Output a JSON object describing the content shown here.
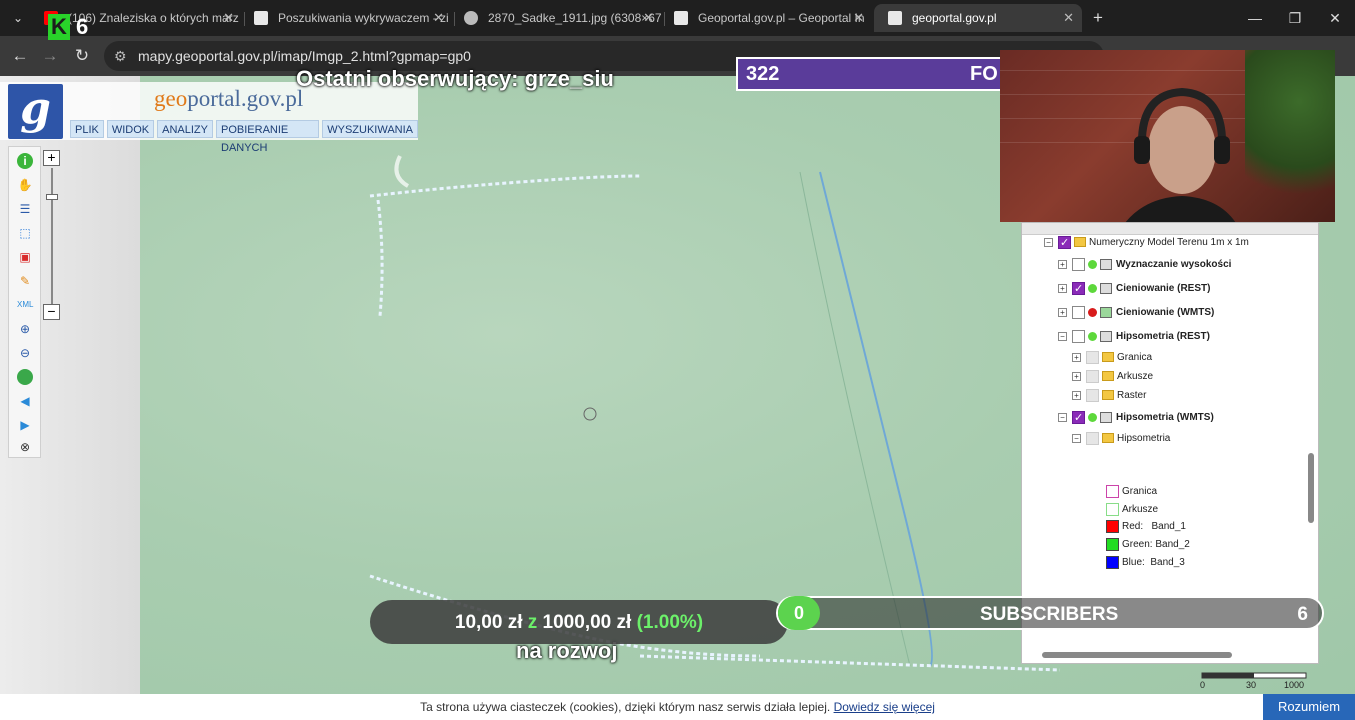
{
  "browser": {
    "tabs": [
      {
        "title": "(106) Znaleziska o których marz",
        "icon_color": "#ff0000"
      },
      {
        "title": "Poszukiwania wykrywaczem - zi",
        "icon_color": "#e8e8e8"
      },
      {
        "title": "2870_Sadke_1911.jpg (6308×67",
        "icon_color": "#bbbbbb"
      },
      {
        "title": "Geoportal.gov.pl – Geoportal In",
        "icon_color": "#e8e8e8"
      },
      {
        "title": "geoportal.gov.pl",
        "icon_color": "#e8e8e8"
      }
    ],
    "new_tab": "+",
    "url": "mapy.geoportal.gov.pl/imap/Imgp_2.html?gpmap=gp0"
  },
  "geoportal": {
    "logo_letter": "g",
    "logo_pre": "geo",
    "logo_post": "portal.gov.pl",
    "menu": [
      "PLIK",
      "WIDOK",
      "ANALIZY",
      "POBIERANIE DANYCH",
      "WYSZUKIWANIA"
    ],
    "zoom_in": "+",
    "zoom_out": "−"
  },
  "tools": [
    "info-icon",
    "hand-icon",
    "layers-list-icon",
    "select-icon",
    "erase-icon",
    "pencil-icon",
    "xml-icon",
    "zoom-in-icon",
    "zoom-out-icon",
    "globe-icon",
    "back-icon",
    "forward-icon",
    "measure-icon"
  ],
  "layers": {
    "root": "Numeryczny Model Terenu 1m x 1m",
    "items": [
      {
        "label": "Wyznaczanie wysokości",
        "checked": false,
        "dot": "#5dd83b"
      },
      {
        "label": "Cieniowanie (REST)",
        "checked": true,
        "dot": "#5dd83b"
      },
      {
        "label": "Cieniowanie (WMTS)",
        "checked": false,
        "dot": "#d81b1b"
      },
      {
        "label": "Hipsometria (REST)",
        "checked": false,
        "dot": "#5dd83b"
      },
      {
        "label": "Granica"
      },
      {
        "label": "Arkusze"
      },
      {
        "label": "Raster"
      },
      {
        "label": "Hipsometria (WMTS)",
        "checked": true,
        "dot": "#5dd83b"
      },
      {
        "label": "Hipsometria"
      }
    ],
    "legend": [
      {
        "label": "Granica",
        "color": "#ffffff",
        "border": "#cc44aa"
      },
      {
        "label": "Arkusze",
        "color": "#ffffff",
        "border": "#88dd88"
      },
      {
        "label": "Red:   Band_1",
        "color": "#ff0000",
        "border": "#444444"
      },
      {
        "label": "Green: Band_2",
        "color": "#22dd22",
        "border": "#444444"
      },
      {
        "label": "Blue:  Band_3",
        "color": "#0000ff",
        "border": "#444444"
      }
    ]
  },
  "stream": {
    "follower": "Ostatni obserwujący: grze_siu",
    "goal_count": "322",
    "goal_label": "FO",
    "caption": "na rozwoj",
    "donation_amount": "10,00 zł",
    "donation_of": "z",
    "donation_goal": "1000,00 zł",
    "donation_pct": "(1.00%)",
    "subs_bubble": "0",
    "subs_label": "SUBSCRIBERS",
    "subs_count": "6",
    "k_badge": "K",
    "k_count": "6"
  },
  "cookie": {
    "text": "Ta strona używa ciasteczek (cookies), dzięki którym nasz serwis działa lepiej.",
    "link": "Dowiedz się więcej",
    "button": "Rozumiem"
  },
  "scale": {
    "left": "0",
    "mid": "30",
    "right": "1000"
  }
}
